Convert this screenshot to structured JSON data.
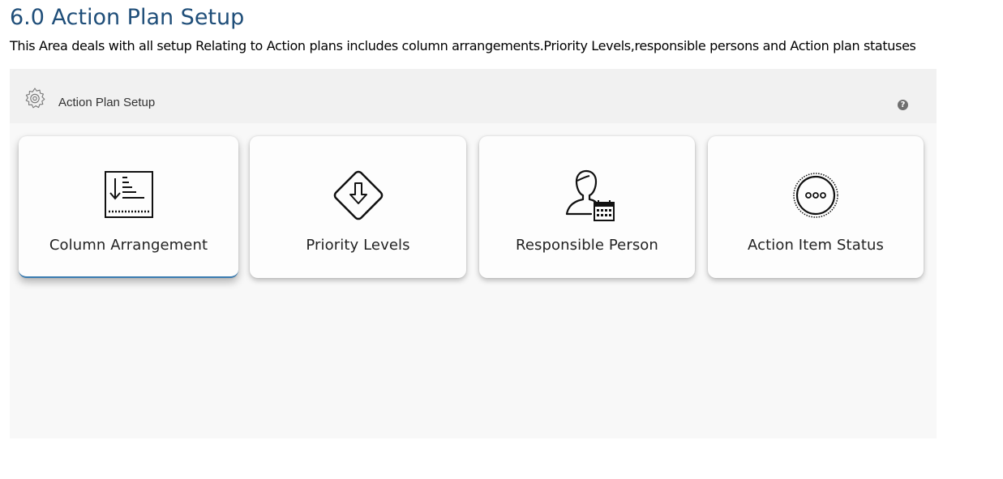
{
  "document": {
    "heading": "6.0 Action Plan Setup",
    "description": "This Area deals with all setup Relating to Action plans includes column arrangements.Priority Levels,responsible persons and Action plan statuses"
  },
  "panel": {
    "title": "Action Plan Setup",
    "help_glyph": "?",
    "accent_color": "#3a7bb0",
    "cards": [
      {
        "label": "Column Arrangement",
        "icon": "sort-list-icon",
        "active": true
      },
      {
        "label": "Priority Levels",
        "icon": "priority-diamond-icon",
        "active": false
      },
      {
        "label": "Responsible Person",
        "icon": "person-calendar-icon",
        "active": false
      },
      {
        "label": "Action Item Status",
        "icon": "status-dots-icon",
        "active": false
      }
    ]
  }
}
